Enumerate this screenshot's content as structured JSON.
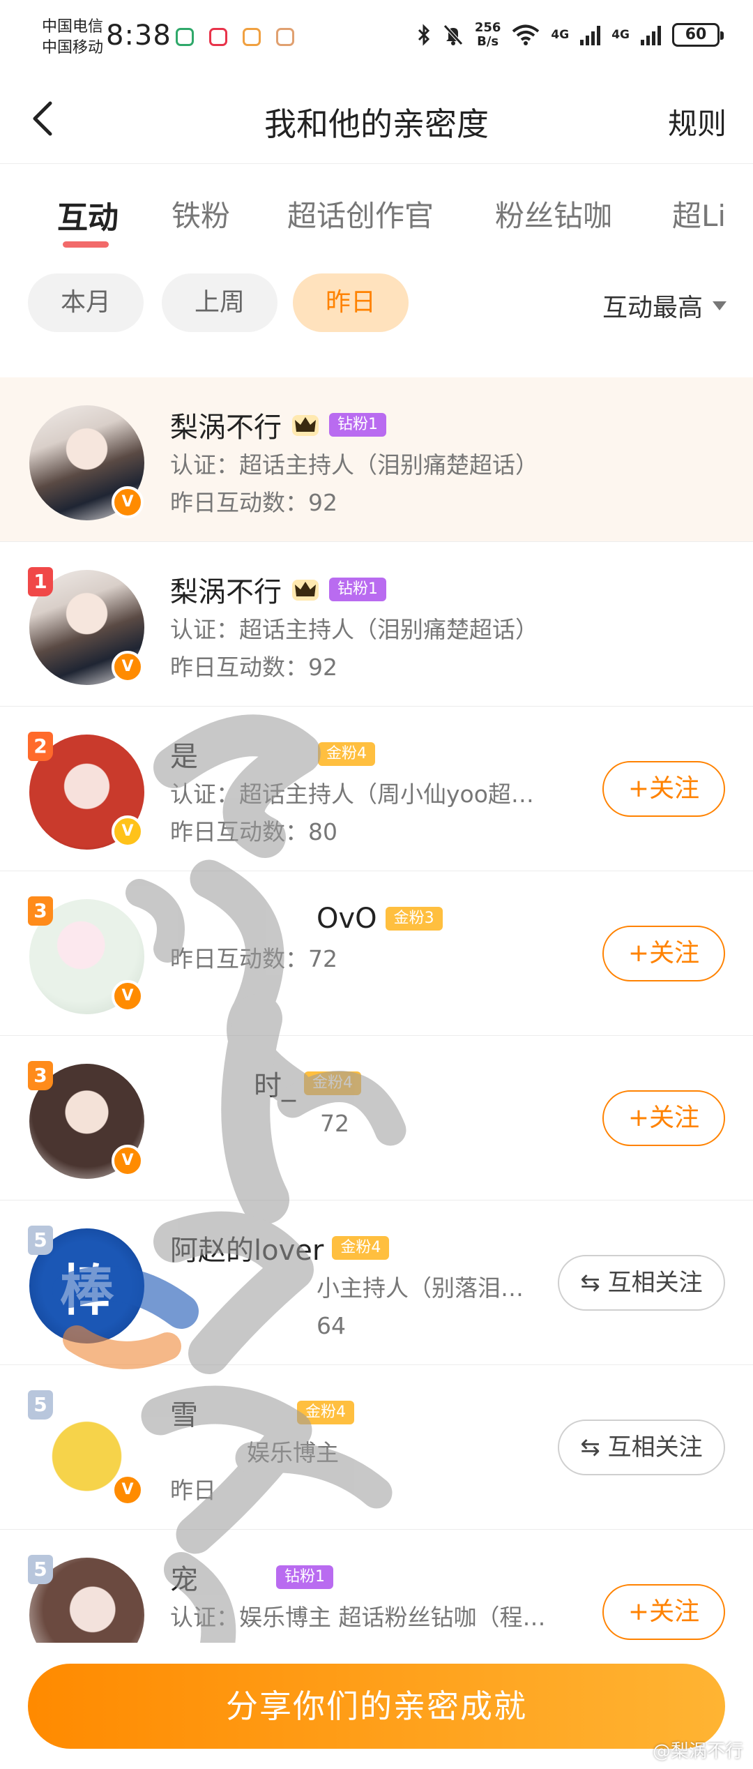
{
  "status_bar": {
    "carrier1": "中国电信",
    "carrier2": "中国移动",
    "time": "8:38",
    "net_speed_value": "256",
    "net_speed_unit": "B/s",
    "net1": "4G",
    "net2": "4G",
    "battery": "60"
  },
  "nav": {
    "title": "我和他的亲密度",
    "rules": "规则"
  },
  "tabs": [
    {
      "label": "互动"
    },
    {
      "label": "铁粉"
    },
    {
      "label": "超话创作官"
    },
    {
      "label": "粉丝钻咖"
    },
    {
      "label": "超Li"
    }
  ],
  "filters": [
    {
      "label": "本月"
    },
    {
      "label": "上周"
    },
    {
      "label": "昨日"
    }
  ],
  "sort_label": "互动最高",
  "colors": {
    "accent": "#ff8200",
    "tab_underline": "#f26a6a",
    "rank1": "#f04848",
    "rank2": "#ff6a2b",
    "rank3": "#ff8b1a",
    "rank_other": "#b8c6dc",
    "vip_orange": "#ff8b00",
    "vip_yellow": "#ffc21a"
  },
  "self_row": {
    "nickname": "梨涡不行",
    "badge": "钻粉1",
    "cert": "认证：超话主持人（泪别痛楚超话）",
    "count": "昨日互动数：92"
  },
  "rows": [
    {
      "rank": "1",
      "nickname": "梨涡不行",
      "badge": "钻粉1",
      "cert": "认证：超话主持人（泪别痛楚超话）",
      "count": "昨日互动数：92",
      "button": ""
    },
    {
      "rank": "2",
      "nickname": "是",
      "badge": "金粉4",
      "cert": "认证：超话主持人（周小仙yoo超…",
      "count": "昨日互动数：80",
      "button": "+关注"
    },
    {
      "rank": "3",
      "nickname": "OvO",
      "badge": "金粉3",
      "cert": "",
      "count": "昨日互动数：72",
      "button": "+关注"
    },
    {
      "rank": "3",
      "nickname": "时_",
      "badge": "金粉4",
      "cert": "",
      "count": "72",
      "button": "+关注"
    },
    {
      "rank": "5",
      "nickname": "阿赵的lover",
      "badge": "金粉4",
      "cert": "小主持人（别落泪…",
      "count": "64",
      "button": "互相关注"
    },
    {
      "rank": "5",
      "nickname": "雪",
      "badge": "金粉4",
      "cert": "娱乐博主",
      "count": "昨日",
      "button": "互相关注"
    },
    {
      "rank": "5",
      "nickname": "宠",
      "badge": "钻粉1",
      "cert": "认证：娱乐博主 超话粉丝钻咖（程…",
      "count": "",
      "button": "+关注"
    }
  ],
  "share_button": "分享你们的亲密成就",
  "watermark": "@梨涡不行"
}
